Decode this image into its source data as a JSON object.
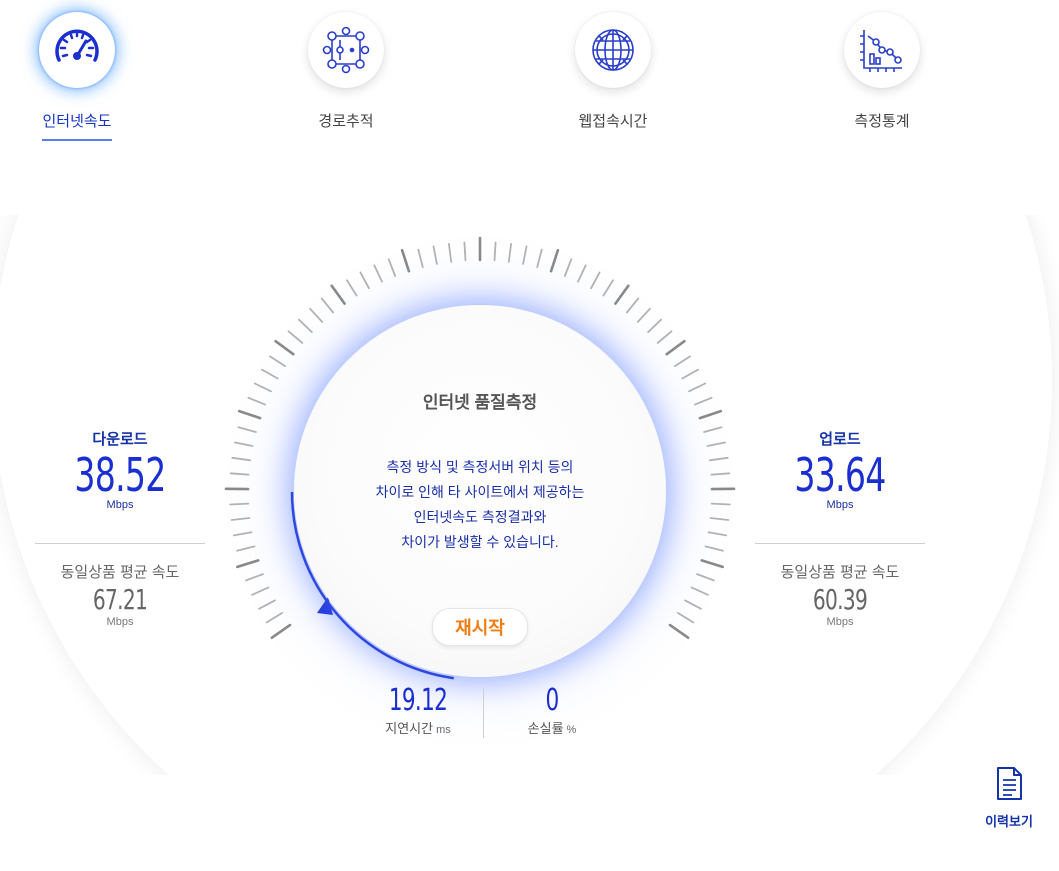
{
  "nav": {
    "items": [
      {
        "label": "인터넷속도",
        "icon": "speedometer-icon",
        "active": true
      },
      {
        "label": "경로추적",
        "icon": "route-trace-icon",
        "active": false
      },
      {
        "label": "웹접속시간",
        "icon": "globe-icon",
        "active": false
      },
      {
        "label": "측정통계",
        "icon": "statistics-icon",
        "active": false
      }
    ]
  },
  "gauge": {
    "title": "인터넷 품질측정",
    "message_lines": [
      "측정 방식 및 측정서버 위치 등의",
      "차이로 인해 타 사이트에서 제공하는",
      "인터넷속도 측정결과와",
      "차이가 발생할 수 있습니다."
    ],
    "restart_label": "재시작"
  },
  "download": {
    "title": "다운로드",
    "value": "38.52",
    "unit": "Mbps",
    "avg_title": "동일상품 평균 속도",
    "avg_value": "67.21",
    "avg_unit": "Mbps"
  },
  "upload": {
    "title": "업로드",
    "value": "33.64",
    "unit": "Mbps",
    "avg_title": "동일상품 평균 속도",
    "avg_value": "60.39",
    "avg_unit": "Mbps"
  },
  "latency": {
    "value": "19.12",
    "label": "지연시간",
    "unit": "ms"
  },
  "loss": {
    "value": "0",
    "label": "손실률",
    "unit": "%"
  },
  "history": {
    "label": "이력보기",
    "icon": "document-icon"
  },
  "colors": {
    "accent": "#1b2fd1",
    "accent_dark": "#1433a8",
    "restart": "#f07d12",
    "glow": "#5b7cf0"
  }
}
